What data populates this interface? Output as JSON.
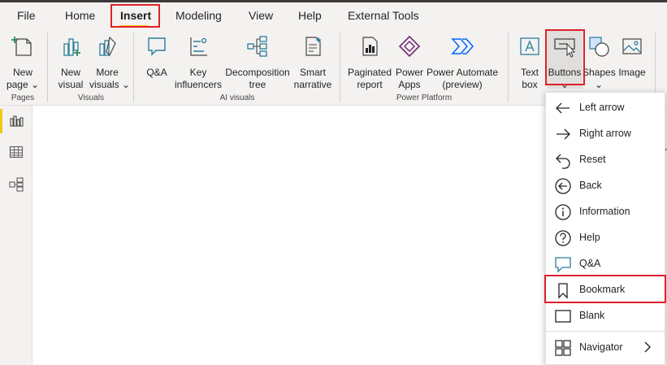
{
  "tabs": [
    "File",
    "Home",
    "Insert",
    "Modeling",
    "View",
    "Help",
    "External Tools"
  ],
  "ribbon": {
    "new_page": [
      "New",
      "page ⌄"
    ],
    "new_visual": [
      "New",
      "visual"
    ],
    "more_visuals": [
      "More",
      "visuals ⌄"
    ],
    "qa": [
      "Q&A"
    ],
    "key_influencers": [
      "Key",
      "influencers"
    ],
    "decomposition_tree": [
      "Decomposition",
      "tree"
    ],
    "smart_narrative": [
      "Smart",
      "narrative"
    ],
    "paginated_report": [
      "Paginated",
      "report"
    ],
    "power_apps": [
      "Power",
      "Apps"
    ],
    "power_automate": [
      "Power Automate",
      "(preview)"
    ],
    "text_box": [
      "Text",
      "box"
    ],
    "buttons": [
      "Buttons",
      "⌄"
    ],
    "shapes": [
      "Shapes",
      "⌄"
    ],
    "image": [
      "Image"
    ]
  },
  "groups": {
    "pages": "Pages",
    "visuals": "Visuals",
    "ai_visuals": "AI visuals",
    "power_platform": "Power Platform"
  },
  "menu": {
    "left_arrow": "Left arrow",
    "right_arrow": "Right arrow",
    "reset": "Reset",
    "back": "Back",
    "information": "Information",
    "help": "Help",
    "qa": "Q&A",
    "bookmark": "Bookmark",
    "blank": "Blank",
    "navigator": "Navigator"
  },
  "colors": {
    "accent": "#f2c811",
    "highlight_border": "#e0202a",
    "icon_teal": "#2b7d9a",
    "power_apps": "#742774",
    "power_automate": "#0066ff"
  }
}
